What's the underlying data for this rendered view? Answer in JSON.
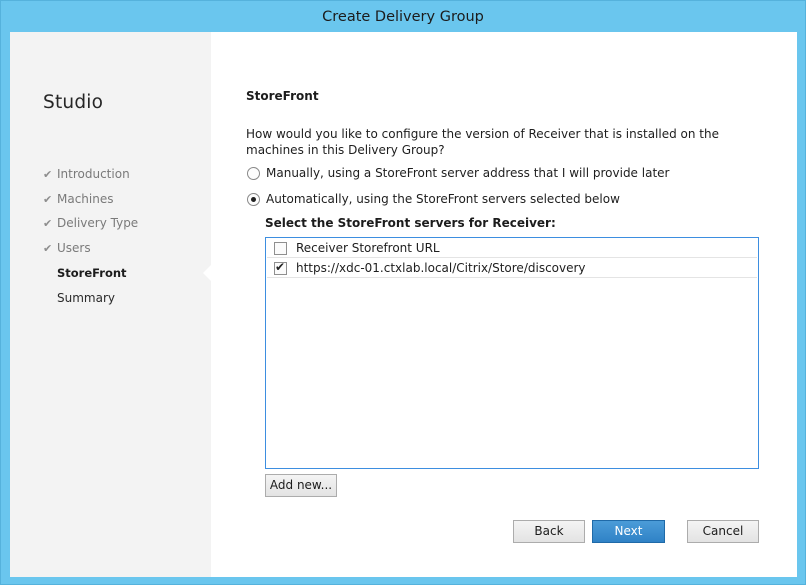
{
  "window": {
    "title": "Create Delivery Group"
  },
  "sidebar": {
    "title": "Studio",
    "steps": [
      {
        "label": "Introduction",
        "state": "completed"
      },
      {
        "label": "Machines",
        "state": "completed"
      },
      {
        "label": "Delivery Type",
        "state": "completed"
      },
      {
        "label": "Users",
        "state": "completed"
      },
      {
        "label": "StoreFront",
        "state": "current"
      },
      {
        "label": "Summary",
        "state": "pending"
      }
    ]
  },
  "main": {
    "heading": "StoreFront",
    "question": "How would you like to configure the version of Receiver that is installed on the machines in this Delivery Group?",
    "options": [
      {
        "label": "Manually, using a StoreFront server address that I will provide later",
        "selected": false
      },
      {
        "label": "Automatically, using the StoreFront servers selected below",
        "selected": true
      }
    ],
    "select_label": "Select the StoreFront servers for Receiver:",
    "list": {
      "header": "Receiver Storefront URL",
      "header_checked": false,
      "rows": [
        {
          "url": "https://xdc-01.ctxlab.local/Citrix/Store/discovery",
          "checked": true
        }
      ]
    },
    "add_new_label": "Add new..."
  },
  "footer": {
    "back_label": "Back",
    "next_label": "Next",
    "cancel_label": "Cancel"
  },
  "colors": {
    "titlebar": "#6ac6ee",
    "sidebar_bg": "#f3f3f3",
    "primary_button": "#2f82c6",
    "list_border": "#3d8ee0"
  }
}
